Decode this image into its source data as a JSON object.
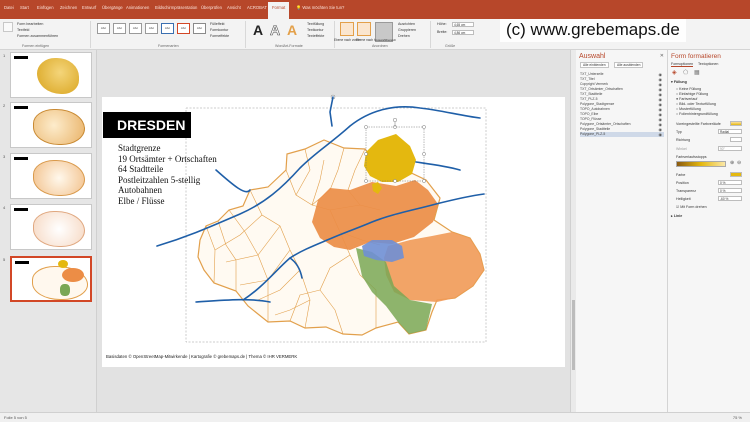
{
  "watermark": "(c) www.grebemaps.de",
  "tabs": [
    "Datei",
    "Start",
    "Einfügen",
    "Zeichnen",
    "Entwurf",
    "Übergänge",
    "Animationen",
    "Bildschirmpräsentation",
    "Überprüfen",
    "Ansicht",
    "ACROBAT",
    "Format"
  ],
  "tell_me": "Was möchten Sie tun?",
  "ribbon": {
    "insert_shapes": [
      "Form bearbeiten",
      "Textfeld",
      "Formen zusammenführen"
    ],
    "group_insert_shapes": "Formen einfügen",
    "style_swatch": "Abc",
    "group_shape_styles": "Formenarten",
    "fill_label": "Fülleffekt",
    "outline_label": "Formkontur",
    "effects_label": "Formeffekte",
    "wordart_letter": "A",
    "group_wordart": "WordArt-Formate",
    "text_options": [
      "Textfüllung",
      "Textkontur",
      "Texteffekte"
    ],
    "arrange_forward": "Ebene nach vorne",
    "arrange_backward": "Ebene nach hinten",
    "selection_pane_label": "Auswahlbereich",
    "arrange_align": [
      "Ausrichten",
      "Gruppieren",
      "Drehen"
    ],
    "group_arrange": "Anordnen",
    "height_label": "Höhe:",
    "height_value": "4,65 cm",
    "width_label": "Breite:",
    "width_value": "4,86 cm",
    "group_size": "Größe"
  },
  "thumbnails": [
    "1",
    "2",
    "3",
    "4",
    "5"
  ],
  "slide": {
    "title": "DRESDEN",
    "legend": [
      "Stadtgrenze",
      "19 Ortsämter + Ortschaften",
      "64 Stadtteile",
      "Postleitzahlen 5-stellig",
      "Autobahnen",
      "Elbe / Flüsse"
    ],
    "source": "Basisdaten © OpenStreetMap-Mitwirkende | Kartografie © grebemaps.de | Thema © IHR VERMERK"
  },
  "map_colors": {
    "district_fill": "#fffaf2",
    "district_border": "#e2a04c",
    "highlight_yellow": "#e4b80f",
    "orange_east": "#ec8d46",
    "orange_se": "#f19a58",
    "green_south": "#7aa755",
    "blue_lake": "#6f8fd5",
    "river": "#1f5fa8"
  },
  "selection_pane": {
    "title": "Auswahl",
    "show_all": "Alle einblenden",
    "hide_all": "Alle ausblenden",
    "items": [
      "TXT_Unterzeile",
      "TXT_Titel",
      "Copyright Vermerk",
      "TXT_Ortsämter_Ortschaften",
      "TXT_Stadtteile",
      "TXT_PLZ-5",
      "Polygone_Stadtgrenze",
      "TOPO_Autobahnen",
      "TOPO_Elbe",
      "TOPO_Flüsse",
      "Polygone_Ortsämter_Ortschaften",
      "Polygone_Stadtteile",
      "Polygone_PLZ-5"
    ]
  },
  "format_pane": {
    "title": "Form formatieren",
    "tab1": "Formoptionen",
    "tab2": "Textoptionen",
    "section_fill": "Füllung",
    "fill_options": [
      "Keine Füllung",
      "Einfarbige Füllung",
      "Farbverlauf",
      "Bild- oder Texturfüllung",
      "Musterfüllung",
      "Folienhintergrundfüllung"
    ],
    "preset_label": "Voreingestellte Farbverläufe",
    "type_label": "Typ",
    "type_value": "Radial",
    "direction_label": "Richtung",
    "angle_label": "Winkel",
    "angle_value": "90°",
    "stops_label": "Farbverlaufsstopps",
    "color_label": "Farbe",
    "position_label": "Position",
    "position_value": "0 %",
    "transparency_label": "Transparenz",
    "transparency_value": "0 %",
    "brightness_label": "Helligkeit",
    "brightness_value": "-60 %",
    "rotate_label": "Mit Form drehen",
    "line_label": "Linie"
  },
  "status": {
    "slide": "Folie 5 von 5",
    "zoom": "75 %"
  }
}
